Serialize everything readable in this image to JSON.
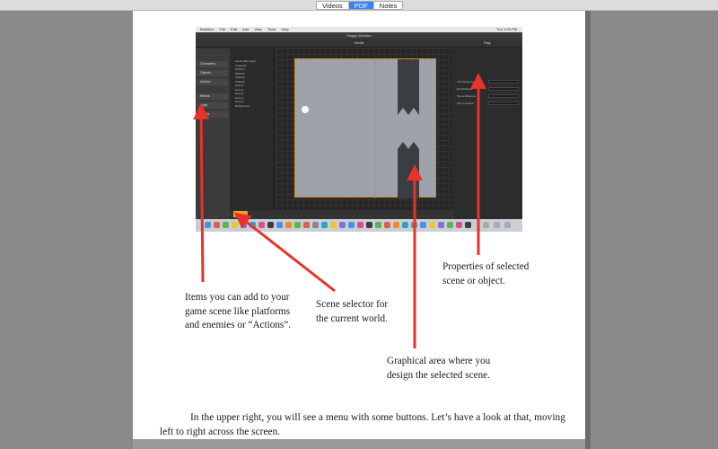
{
  "tabs": {
    "videos": "Videos",
    "pdf": "PDF",
    "notes": "Notes"
  },
  "screenshot": {
    "menubar": {
      "app": "Buildbox",
      "file": "File",
      "edit": "Edit",
      "add": "Add",
      "view": "View",
      "tools": "Tools",
      "help": "Help",
      "clock": "Thu 1:05 PM"
    },
    "window_title": "Flappy Monster",
    "toolbar_world": "World",
    "toolbar_play": "Play",
    "left_items": [
      "Characters",
      "Objects",
      "Actions",
      "Effects",
      "Logic",
      "Labels"
    ],
    "tree_items": [
      "Game Play Layer",
      "Character",
      "Platform",
      "Platform",
      "Platform",
      "Platform",
      "Enemy",
      "Enemy",
      "Enemy",
      "Enemy",
      "Enemy",
      "Background"
    ],
    "props_rows": [
      {
        "label": "Start Distance",
        "value": "0"
      },
      {
        "label": "End Distance",
        "value": "0"
      },
      {
        "label": "Scene Distance",
        "value": "708"
      },
      {
        "label": "Play Condition",
        "value": "0"
      }
    ],
    "bottom_button": "World",
    "add_label": "Add"
  },
  "annotations": {
    "items": "Items you can add to your\ngame scene like platforms\nand enemies or “Actions”.",
    "scene_selector": "Scene selector for\nthe current world.",
    "graphical_area": "Graphical area where you\ndesign the selected scene.",
    "properties": "Properties of selected\nscene or object."
  },
  "paragraph": "In the upper right, you will see a menu with some buttons. Let’s have a look at that, moving left to right across the screen.",
  "colors": {
    "arrow": "#e8322a",
    "world_border": "#d38b1c",
    "active_tab": "#3b82f6"
  }
}
